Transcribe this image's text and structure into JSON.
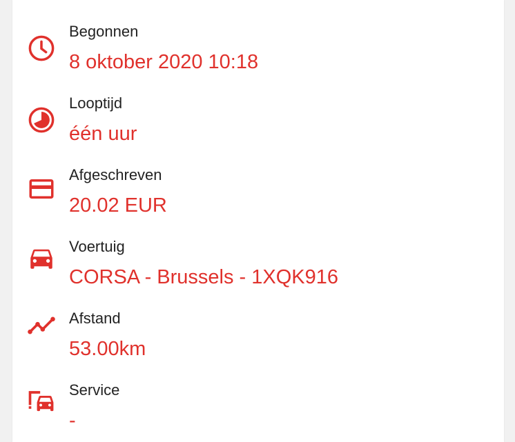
{
  "accent_color": "#e0312c",
  "details": [
    {
      "icon": "clock-icon",
      "label": "Begonnen",
      "value": "8 oktober 2020 10:18"
    },
    {
      "icon": "duration-pie-icon",
      "label": "Looptijd",
      "value": "één uur"
    },
    {
      "icon": "credit-card-icon",
      "label": "Afgeschreven",
      "value": "20.02 EUR"
    },
    {
      "icon": "car-icon",
      "label": "Voertuig",
      "value": "CORSA - Brussels - 1XQK916"
    },
    {
      "icon": "distance-trend-icon",
      "label": "Afstand",
      "value": "53.00km"
    },
    {
      "icon": "car-service-icon",
      "label": "Service",
      "value": "-"
    }
  ]
}
